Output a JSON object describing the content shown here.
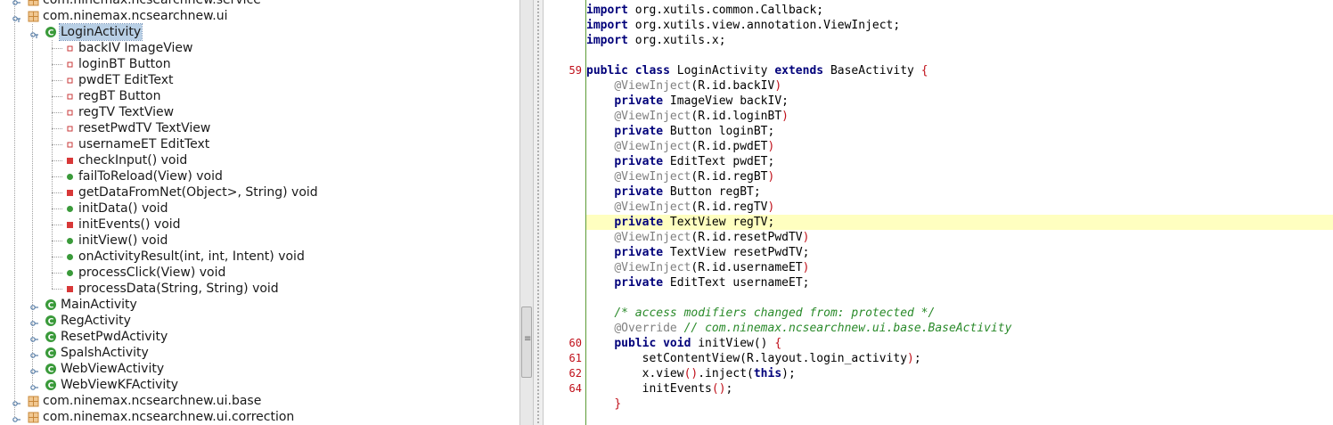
{
  "tree": {
    "rows": [
      {
        "kind": "package",
        "label": "com.ninemax.ncsearchnew.service",
        "depth": 0,
        "expanded": false
      },
      {
        "kind": "package",
        "label": "com.ninemax.ncsearchnew.ui",
        "depth": 0,
        "expanded": true
      },
      {
        "kind": "class",
        "label": "LoginActivity",
        "depth": 1,
        "expanded": true,
        "selected": true
      },
      {
        "kind": "field",
        "label": "backIV ImageView",
        "depth": 2
      },
      {
        "kind": "field",
        "label": "loginBT Button",
        "depth": 2
      },
      {
        "kind": "field",
        "label": "pwdET EditText",
        "depth": 2
      },
      {
        "kind": "field",
        "label": "regBT Button",
        "depth": 2
      },
      {
        "kind": "field",
        "label": "regTV TextView",
        "depth": 2
      },
      {
        "kind": "field",
        "label": "resetPwdTV TextView",
        "depth": 2
      },
      {
        "kind": "field",
        "label": "usernameET EditText",
        "depth": 2
      },
      {
        "kind": "method-private",
        "label": "checkInput() void",
        "depth": 2
      },
      {
        "kind": "method-public",
        "label": "failToReload(View) void",
        "depth": 2
      },
      {
        "kind": "method-private",
        "label": "getDataFromNet(Object>, String) void",
        "depth": 2
      },
      {
        "kind": "method-public",
        "label": "initData() void",
        "depth": 2
      },
      {
        "kind": "method-private",
        "label": "initEvents() void",
        "depth": 2
      },
      {
        "kind": "method-public",
        "label": "initView() void",
        "depth": 2
      },
      {
        "kind": "method-public",
        "label": "onActivityResult(int, int, Intent) void",
        "depth": 2
      },
      {
        "kind": "method-public",
        "label": "processClick(View) void",
        "depth": 2
      },
      {
        "kind": "method-private",
        "label": "processData(String, String) void",
        "depth": 2
      },
      {
        "kind": "class",
        "label": "MainActivity",
        "depth": 1,
        "expanded": false
      },
      {
        "kind": "class",
        "label": "RegActivity",
        "depth": 1,
        "expanded": false
      },
      {
        "kind": "class",
        "label": "ResetPwdActivity",
        "depth": 1,
        "expanded": false
      },
      {
        "kind": "class",
        "label": "SpalshActivity",
        "depth": 1,
        "expanded": false
      },
      {
        "kind": "class",
        "label": "WebViewActivity",
        "depth": 1,
        "expanded": false
      },
      {
        "kind": "class",
        "label": "WebViewKFActivity",
        "depth": 1,
        "expanded": false
      },
      {
        "kind": "package",
        "label": "com.ninemax.ncsearchnew.ui.base",
        "depth": 0,
        "expanded": false
      },
      {
        "kind": "package",
        "label": "com.ninemax.ncsearchnew.ui.correction",
        "depth": 0,
        "expanded": false
      }
    ]
  },
  "editor": {
    "lines": [
      {
        "num": "",
        "tokens": [
          [
            "kw",
            "import"
          ],
          [
            "plain",
            " org.xutils.common.Callback;"
          ]
        ]
      },
      {
        "num": "",
        "tokens": [
          [
            "kw",
            "import"
          ],
          [
            "plain",
            " org.xutils.view.annotation.ViewInject;"
          ]
        ]
      },
      {
        "num": "",
        "tokens": [
          [
            "kw",
            "import"
          ],
          [
            "plain",
            " org.xutils.x;"
          ]
        ]
      },
      {
        "num": "",
        "tokens": []
      },
      {
        "num": "59",
        "tokens": [
          [
            "kw",
            "public class"
          ],
          [
            "plain",
            " LoginActivity "
          ],
          [
            "kw",
            "extends"
          ],
          [
            "plain",
            " BaseActivity "
          ],
          [
            "brace",
            "{"
          ]
        ]
      },
      {
        "num": "",
        "tokens": [
          [
            "plain",
            "    "
          ],
          [
            "ann",
            "@ViewInject"
          ],
          [
            "plain",
            "(R.id.backIV"
          ],
          [
            "brace",
            ")"
          ]
        ]
      },
      {
        "num": "",
        "tokens": [
          [
            "plain",
            "    "
          ],
          [
            "kw",
            "private"
          ],
          [
            "plain",
            " ImageView backIV;"
          ]
        ]
      },
      {
        "num": "",
        "tokens": [
          [
            "plain",
            "    "
          ],
          [
            "ann",
            "@ViewInject"
          ],
          [
            "plain",
            "(R.id.loginBT"
          ],
          [
            "brace",
            ")"
          ]
        ]
      },
      {
        "num": "",
        "tokens": [
          [
            "plain",
            "    "
          ],
          [
            "kw",
            "private"
          ],
          [
            "plain",
            " Button loginBT;"
          ]
        ]
      },
      {
        "num": "",
        "tokens": [
          [
            "plain",
            "    "
          ],
          [
            "ann",
            "@ViewInject"
          ],
          [
            "plain",
            "(R.id.pwdET"
          ],
          [
            "brace",
            ")"
          ]
        ]
      },
      {
        "num": "",
        "tokens": [
          [
            "plain",
            "    "
          ],
          [
            "kw",
            "private"
          ],
          [
            "plain",
            " EditText pwdET;"
          ]
        ]
      },
      {
        "num": "",
        "tokens": [
          [
            "plain",
            "    "
          ],
          [
            "ann",
            "@ViewInject"
          ],
          [
            "plain",
            "(R.id.regBT"
          ],
          [
            "brace",
            ")"
          ]
        ]
      },
      {
        "num": "",
        "tokens": [
          [
            "plain",
            "    "
          ],
          [
            "kw",
            "private"
          ],
          [
            "plain",
            " Button regBT;"
          ]
        ]
      },
      {
        "num": "",
        "tokens": [
          [
            "plain",
            "    "
          ],
          [
            "ann",
            "@ViewInject"
          ],
          [
            "plain",
            "(R.id.regTV"
          ],
          [
            "brace",
            ")"
          ]
        ]
      },
      {
        "num": "",
        "current": true,
        "tokens": [
          [
            "plain",
            "    "
          ],
          [
            "kw",
            "private"
          ],
          [
            "plain",
            " TextView regTV;"
          ]
        ]
      },
      {
        "num": "",
        "tokens": [
          [
            "plain",
            "    "
          ],
          [
            "ann",
            "@ViewInject"
          ],
          [
            "plain",
            "(R.id.resetPwdTV"
          ],
          [
            "brace",
            ")"
          ]
        ]
      },
      {
        "num": "",
        "tokens": [
          [
            "plain",
            "    "
          ],
          [
            "kw",
            "private"
          ],
          [
            "plain",
            " TextView resetPwdTV;"
          ]
        ]
      },
      {
        "num": "",
        "tokens": [
          [
            "plain",
            "    "
          ],
          [
            "ann",
            "@ViewInject"
          ],
          [
            "plain",
            "(R.id.usernameET"
          ],
          [
            "brace",
            ")"
          ]
        ]
      },
      {
        "num": "",
        "tokens": [
          [
            "plain",
            "    "
          ],
          [
            "kw",
            "private"
          ],
          [
            "plain",
            " EditText usernameET;"
          ]
        ]
      },
      {
        "num": "",
        "tokens": []
      },
      {
        "num": "",
        "tokens": [
          [
            "plain",
            "    "
          ],
          [
            "comment",
            "/* access modifiers changed from: protected */"
          ]
        ]
      },
      {
        "num": "",
        "tokens": [
          [
            "plain",
            "    "
          ],
          [
            "ann",
            "@Override"
          ],
          [
            "plain",
            " "
          ],
          [
            "comment",
            "// com.ninemax.ncsearchnew.ui.base.BaseActivity"
          ]
        ]
      },
      {
        "num": "60",
        "tokens": [
          [
            "plain",
            "    "
          ],
          [
            "kw",
            "public void"
          ],
          [
            "plain",
            " initView() "
          ],
          [
            "brace",
            "{"
          ]
        ]
      },
      {
        "num": "61",
        "tokens": [
          [
            "plain",
            "        setContentView(R.layout.login_activity"
          ],
          [
            "brace",
            ")"
          ],
          [
            "plain",
            ";"
          ]
        ]
      },
      {
        "num": "62",
        "tokens": [
          [
            "plain",
            "        x.view"
          ],
          [
            "brace",
            "()"
          ],
          [
            "plain",
            ".inject("
          ],
          [
            "kw",
            "this"
          ],
          [
            "plain",
            ");"
          ]
        ]
      },
      {
        "num": "64",
        "tokens": [
          [
            "plain",
            "        initEvents"
          ],
          [
            "brace",
            "()"
          ],
          [
            "plain",
            ";"
          ]
        ]
      },
      {
        "num": "",
        "tokens": [
          [
            "plain",
            "    "
          ],
          [
            "brace",
            "}"
          ]
        ]
      }
    ]
  },
  "colors": {
    "keyword": "#00007a",
    "annotation": "#808080",
    "comment": "#2a8a2a",
    "brace": "#c0101a",
    "plain": "#000000",
    "current_line": "#ffffc0",
    "class_icon": "#3a9a3a",
    "package_icon": "#c8883a",
    "field_icon": "#c8383a",
    "method_public_icon": "#3a9a3a",
    "method_private_icon": "#d83838"
  },
  "icons": {
    "package": "package-icon",
    "class": "class-icon",
    "field": "private-field-icon",
    "method-public": "public-method-icon",
    "method-private": "private-method-icon",
    "expander-open": "expander-open-icon",
    "expander-closed": "expander-closed-icon"
  }
}
